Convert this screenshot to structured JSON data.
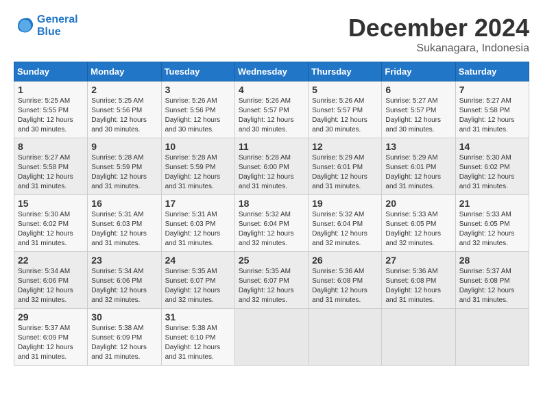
{
  "header": {
    "logo_line1": "General",
    "logo_line2": "Blue",
    "month": "December 2024",
    "location": "Sukanagara, Indonesia"
  },
  "columns": [
    "Sunday",
    "Monday",
    "Tuesday",
    "Wednesday",
    "Thursday",
    "Friday",
    "Saturday"
  ],
  "weeks": [
    [
      {
        "day": "1",
        "sunrise": "5:25 AM",
        "sunset": "5:55 PM",
        "daylight": "12 hours and 30 minutes."
      },
      {
        "day": "2",
        "sunrise": "5:25 AM",
        "sunset": "5:56 PM",
        "daylight": "12 hours and 30 minutes."
      },
      {
        "day": "3",
        "sunrise": "5:26 AM",
        "sunset": "5:56 PM",
        "daylight": "12 hours and 30 minutes."
      },
      {
        "day": "4",
        "sunrise": "5:26 AM",
        "sunset": "5:57 PM",
        "daylight": "12 hours and 30 minutes."
      },
      {
        "day": "5",
        "sunrise": "5:26 AM",
        "sunset": "5:57 PM",
        "daylight": "12 hours and 30 minutes."
      },
      {
        "day": "6",
        "sunrise": "5:27 AM",
        "sunset": "5:57 PM",
        "daylight": "12 hours and 30 minutes."
      },
      {
        "day": "7",
        "sunrise": "5:27 AM",
        "sunset": "5:58 PM",
        "daylight": "12 hours and 31 minutes."
      }
    ],
    [
      {
        "day": "8",
        "sunrise": "5:27 AM",
        "sunset": "5:58 PM",
        "daylight": "12 hours and 31 minutes."
      },
      {
        "day": "9",
        "sunrise": "5:28 AM",
        "sunset": "5:59 PM",
        "daylight": "12 hours and 31 minutes."
      },
      {
        "day": "10",
        "sunrise": "5:28 AM",
        "sunset": "5:59 PM",
        "daylight": "12 hours and 31 minutes."
      },
      {
        "day": "11",
        "sunrise": "5:28 AM",
        "sunset": "6:00 PM",
        "daylight": "12 hours and 31 minutes."
      },
      {
        "day": "12",
        "sunrise": "5:29 AM",
        "sunset": "6:01 PM",
        "daylight": "12 hours and 31 minutes."
      },
      {
        "day": "13",
        "sunrise": "5:29 AM",
        "sunset": "6:01 PM",
        "daylight": "12 hours and 31 minutes."
      },
      {
        "day": "14",
        "sunrise": "5:30 AM",
        "sunset": "6:02 PM",
        "daylight": "12 hours and 31 minutes."
      }
    ],
    [
      {
        "day": "15",
        "sunrise": "5:30 AM",
        "sunset": "6:02 PM",
        "daylight": "12 hours and 31 minutes."
      },
      {
        "day": "16",
        "sunrise": "5:31 AM",
        "sunset": "6:03 PM",
        "daylight": "12 hours and 31 minutes."
      },
      {
        "day": "17",
        "sunrise": "5:31 AM",
        "sunset": "6:03 PM",
        "daylight": "12 hours and 31 minutes."
      },
      {
        "day": "18",
        "sunrise": "5:32 AM",
        "sunset": "6:04 PM",
        "daylight": "12 hours and 32 minutes."
      },
      {
        "day": "19",
        "sunrise": "5:32 AM",
        "sunset": "6:04 PM",
        "daylight": "12 hours and 32 minutes."
      },
      {
        "day": "20",
        "sunrise": "5:33 AM",
        "sunset": "6:05 PM",
        "daylight": "12 hours and 32 minutes."
      },
      {
        "day": "21",
        "sunrise": "5:33 AM",
        "sunset": "6:05 PM",
        "daylight": "12 hours and 32 minutes."
      }
    ],
    [
      {
        "day": "22",
        "sunrise": "5:34 AM",
        "sunset": "6:06 PM",
        "daylight": "12 hours and 32 minutes."
      },
      {
        "day": "23",
        "sunrise": "5:34 AM",
        "sunset": "6:06 PM",
        "daylight": "12 hours and 32 minutes."
      },
      {
        "day": "24",
        "sunrise": "5:35 AM",
        "sunset": "6:07 PM",
        "daylight": "12 hours and 32 minutes."
      },
      {
        "day": "25",
        "sunrise": "5:35 AM",
        "sunset": "6:07 PM",
        "daylight": "12 hours and 32 minutes."
      },
      {
        "day": "26",
        "sunrise": "5:36 AM",
        "sunset": "6:08 PM",
        "daylight": "12 hours and 31 minutes."
      },
      {
        "day": "27",
        "sunrise": "5:36 AM",
        "sunset": "6:08 PM",
        "daylight": "12 hours and 31 minutes."
      },
      {
        "day": "28",
        "sunrise": "5:37 AM",
        "sunset": "6:08 PM",
        "daylight": "12 hours and 31 minutes."
      }
    ],
    [
      {
        "day": "29",
        "sunrise": "5:37 AM",
        "sunset": "6:09 PM",
        "daylight": "12 hours and 31 minutes."
      },
      {
        "day": "30",
        "sunrise": "5:38 AM",
        "sunset": "6:09 PM",
        "daylight": "12 hours and 31 minutes."
      },
      {
        "day": "31",
        "sunrise": "5:38 AM",
        "sunset": "6:10 PM",
        "daylight": "12 hours and 31 minutes."
      },
      null,
      null,
      null,
      null
    ]
  ]
}
